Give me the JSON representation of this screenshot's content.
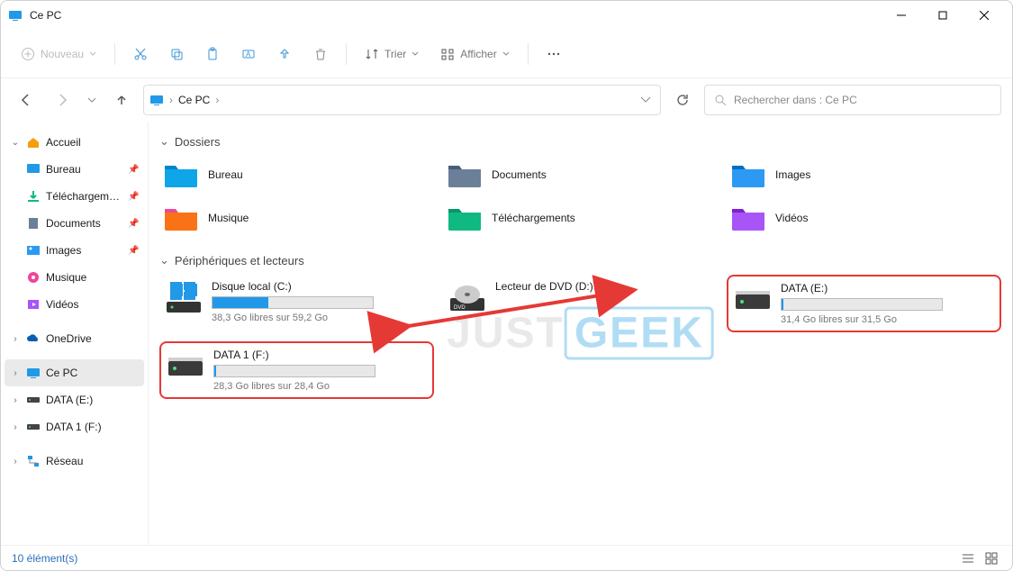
{
  "window": {
    "title": "Ce PC"
  },
  "toolbar": {
    "new": "Nouveau",
    "sort": "Trier",
    "view": "Afficher"
  },
  "breadcrumb": {
    "root": "Ce PC"
  },
  "search": {
    "placeholder": "Rechercher dans : Ce PC"
  },
  "sidebar": {
    "home": "Accueil",
    "quick": [
      {
        "label": "Bureau"
      },
      {
        "label": "Téléchargements"
      },
      {
        "label": "Documents"
      },
      {
        "label": "Images"
      },
      {
        "label": "Musique"
      },
      {
        "label": "Vidéos"
      }
    ],
    "onedrive": "OneDrive",
    "thispc": "Ce PC",
    "dataE": "DATA (E:)",
    "data1F": "DATA 1 (F:)",
    "network": "Réseau"
  },
  "sections": {
    "folders": "Dossiers",
    "drives": "Périphériques et lecteurs"
  },
  "folders": [
    {
      "label": "Bureau",
      "color1": "#0ea5e9",
      "color2": "#0284c7"
    },
    {
      "label": "Documents",
      "color1": "#6b7f99",
      "color2": "#4a5d78"
    },
    {
      "label": "Images",
      "color1": "#2c9af2",
      "color2": "#0a6dc2"
    },
    {
      "label": "Musique",
      "color1": "#f97316",
      "color2": "#ec4899"
    },
    {
      "label": "Téléchargements",
      "color1": "#10b981",
      "color2": "#059669"
    },
    {
      "label": "Vidéos",
      "color1": "#a855f7",
      "color2": "#7e22ce"
    }
  ],
  "drives": [
    {
      "name": "Disque local (C:)",
      "sub": "38,3 Go libres sur 59,2 Go",
      "fill": 35,
      "type": "disk",
      "boxed": false
    },
    {
      "name": "Lecteur de DVD (D:)",
      "sub": "",
      "fill": null,
      "type": "dvd",
      "boxed": false
    },
    {
      "name": "DATA (E:)",
      "sub": "31,4 Go libres sur 31,5 Go",
      "fill": 1,
      "type": "disk",
      "boxed": true
    },
    {
      "name": "DATA 1 (F:)",
      "sub": "28,3 Go libres sur 28,4 Go",
      "fill": 1,
      "type": "disk",
      "boxed": true
    }
  ],
  "status": {
    "count": "10 élément(s)"
  },
  "watermark": {
    "a": "JUST",
    "b": "GEEK"
  }
}
